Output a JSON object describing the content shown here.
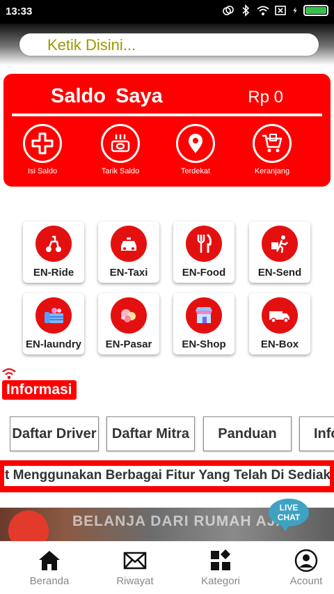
{
  "status_bar": {
    "time": "13:33",
    "icons": [
      "sync-icon",
      "bluetooth-icon",
      "wifi-icon",
      "sim-x-icon",
      "charging-icon",
      "battery-icon"
    ]
  },
  "search": {
    "placeholder": "Ketik Disini..."
  },
  "saldo": {
    "title": "Saldo Saya",
    "amount": "Rp 0",
    "actions": [
      {
        "label": "Isi Saldo",
        "icon": "plus-icon"
      },
      {
        "label": "Tarik Saldo",
        "icon": "withdraw-icon"
      },
      {
        "label": "Terdekat",
        "icon": "location-pin-icon"
      },
      {
        "label": "Keranjang",
        "icon": "cart-icon"
      }
    ]
  },
  "services": [
    {
      "label": "EN-Ride",
      "icon": "scooter-icon"
    },
    {
      "label": "EN-Taxi",
      "icon": "taxi-icon"
    },
    {
      "label": "EN-Food",
      "icon": "fork-knife-icon"
    },
    {
      "label": "EN-Send",
      "icon": "courier-icon"
    },
    {
      "label": "EN-laundry",
      "icon": "laundry-icon"
    },
    {
      "label": "EN-Pasar",
      "icon": "market-icon"
    },
    {
      "label": "EN-Shop",
      "icon": "shop-icon"
    },
    {
      "label": "EN-Box",
      "icon": "truck-icon"
    }
  ],
  "info": {
    "title": "Informasi"
  },
  "tabs": [
    "Daftar Driver",
    "Daftar Mitra",
    "Panduan",
    "Info"
  ],
  "marquee": "t Menggunakan Berbagai Fitur Yang Telah Di Sediakan",
  "banner": {
    "text": "BELANJA DARI RUMAH AJA"
  },
  "live_chat": {
    "line1": "LIVE",
    "line2": "CHAT"
  },
  "bottom_nav": [
    {
      "label": "Beranda",
      "icon": "home-icon"
    },
    {
      "label": "Riwayat",
      "icon": "mail-icon"
    },
    {
      "label": "Kategori",
      "icon": "category-icon"
    },
    {
      "label": "Acount",
      "icon": "account-icon"
    }
  ],
  "colors": {
    "primary": "#fe0000",
    "search_text": "#9a9a00",
    "live_chat": "#3fa2c2"
  }
}
